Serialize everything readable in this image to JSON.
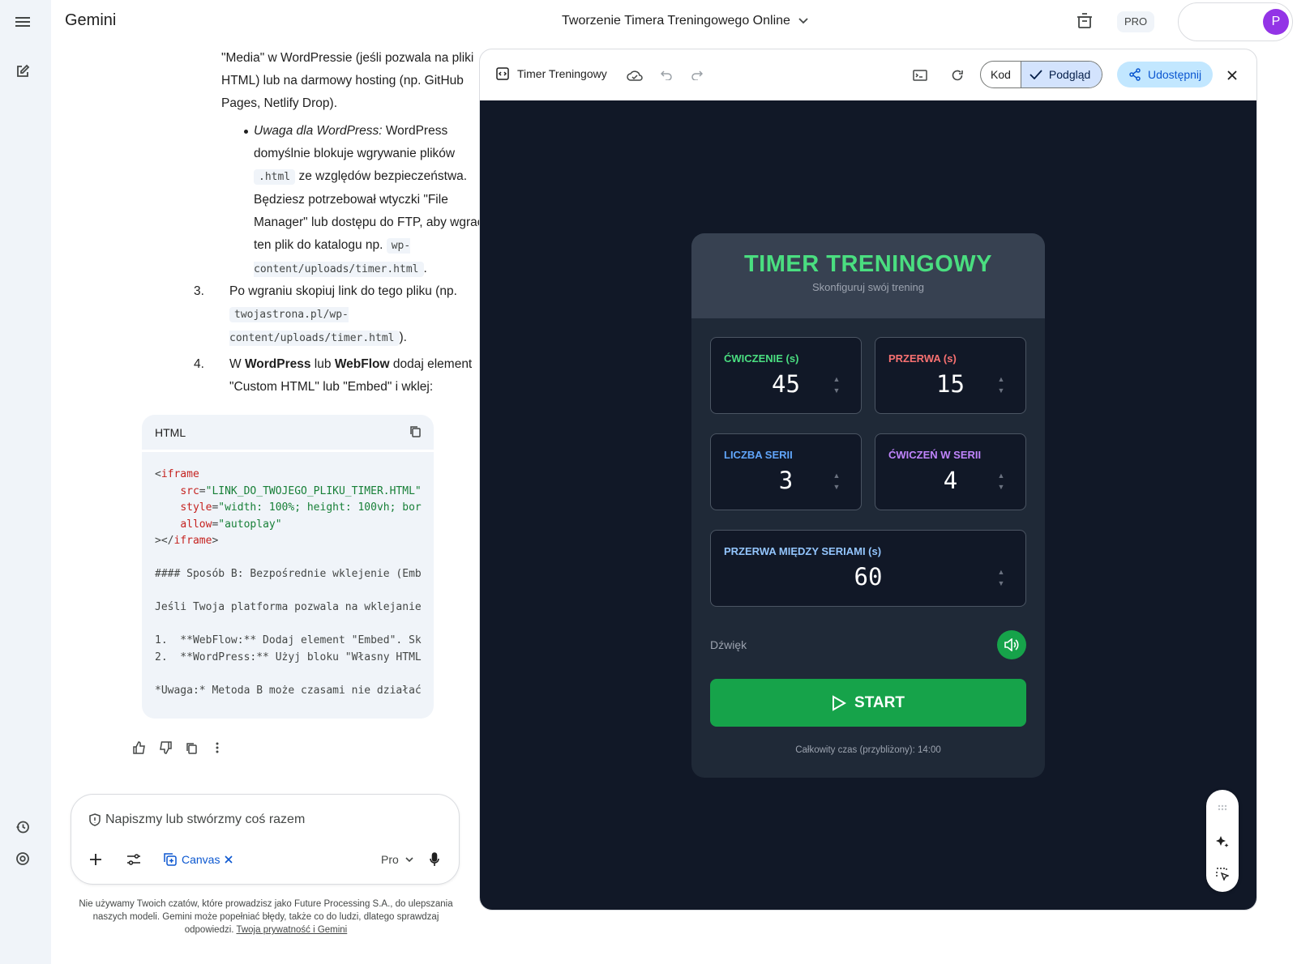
{
  "app": {
    "brand": "Gemini",
    "conversation_title": "Tworzenie Timera Treningowego Online",
    "plan_badge": "PRO",
    "avatar_letter": "P"
  },
  "chat": {
    "p_media": "\"Media\" w WordPressie (jeśli pozwala na pliki HTML) lub na darmowy hosting (np. GitHub Pages, Netlify Drop).",
    "note_italic": "Uwaga dla WordPress:",
    "note_1": " WordPress domyślnie blokuje wgrywanie plików ",
    "note_code": ".html",
    "note_2": " ze względów bezpieczeństwa. Będziesz potrzebował wtyczki \"File Manager\" lub dostępu do FTP, aby wgrać ten plik do katalogu np. ",
    "note_path": "wp-content/uploads/timer.html",
    "note_end": ".",
    "step3_num": "3.",
    "step3_text": "Po wgraniu skopiuj link do tego pliku (np. ",
    "step3_code": "twojastrona.pl/wp-content/uploads/timer.html",
    "step3_end": ").",
    "step4_num": "4.",
    "step4_a": "W ",
    "step4_b": "WordPress",
    "step4_c": " lub ",
    "step4_d": "WebFlow",
    "step4_e": " dodaj element \"Custom HTML\" lub \"Embed\" i wklej:",
    "code_lang": "HTML",
    "code_lines": [
      "#### Sposób B: Bezpośrednie wklejenie (Emb",
      "Jeśli Twoja platforma pozwala na wklejanie",
      "1.  **WebFlow:** Dodaj element \"Embed\". Sk",
      "2.  **WordPress:** Użyj bloku \"Własny HTML",
      "*Uwaga:* Metoda B może czasami nie działać"
    ],
    "code_iframe": {
      "open": "<",
      "tag": "iframe",
      "src_attr": "src",
      "src_val": "\"LINK_DO_TWOJEGO_PLIKU_TIMER.HTML\"",
      "style_attr": "style",
      "style_val": "\"width: 100%; height: 100vh; bor",
      "allow_attr": "allow",
      "allow_val": "\"autoplay\"",
      "close_tag": "iframe",
      "eq": "="
    }
  },
  "composer": {
    "placeholder": "Napiszmy lub stwórzmy coś razem",
    "canvas_label": "Canvas",
    "model_label": "Pro"
  },
  "disclaimer": {
    "text": "Nie używamy Twoich czatów, które prowadzisz jako Future Processing S.A., do ulepszania naszych modeli. Gemini może popełniać błędy, także co do ludzi, dlatego sprawdzaj odpowiedzi. ",
    "link": "Twoja prywatność i Gemini"
  },
  "canvas": {
    "title": "Timer Treningowy",
    "code_label": "Kod",
    "preview_label": "Podgląd",
    "share_label": "Udostępnij"
  },
  "timer": {
    "title": "TIMER TRENINGOWY",
    "subtitle": "Skonfiguruj swój trening",
    "fields": [
      {
        "label": "ĆWICZENIE (s)",
        "value": "45",
        "color": "#4ade80"
      },
      {
        "label": "PRZERWA (s)",
        "value": "15",
        "color": "#f87171"
      },
      {
        "label": "LICZBA SERII",
        "value": "3",
        "color": "#60a5fa"
      },
      {
        "label": "ĆWICZEŃ W SERII",
        "value": "4",
        "color": "#c084fc"
      },
      {
        "label": "PRZERWA MIĘDZY SERIAMI (s)",
        "value": "60",
        "color": "#93c5fd"
      }
    ],
    "sound_label": "Dźwięk",
    "start_label": "START",
    "total": "Całkowity czas (przybliżony): 14:00"
  }
}
